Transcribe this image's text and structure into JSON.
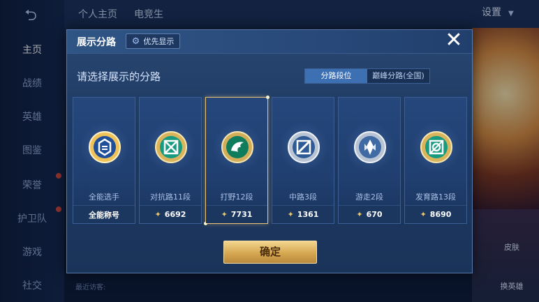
{
  "background": {
    "nav": [
      "主页",
      "战绩",
      "英雄",
      "图鉴",
      "荣誉",
      "护卫队",
      "游戏",
      "社交"
    ],
    "top_tabs": [
      "个人主页",
      "电竞生"
    ],
    "settings_label": "设置",
    "side_actions": [
      "皮肤",
      "换英雄"
    ],
    "recent_label": "最近访客:"
  },
  "modal": {
    "title": "展示分路",
    "priority_label": "优先显示",
    "close_glyph": "✕",
    "subtitle": "请选择展示的分路",
    "toggle": {
      "options": [
        "分路段位",
        "巅峰分路(全国)"
      ],
      "selected": "分路段位"
    },
    "cards": [
      {
        "name": "全能选手",
        "value": "全能称号",
        "selected": false,
        "icon": "all-round-badge-icon"
      },
      {
        "name": "对抗路11段",
        "value": "6692",
        "selected": false,
        "icon": "clash-lane-badge-icon"
      },
      {
        "name": "打野12段",
        "value": "7731",
        "selected": true,
        "icon": "jungle-badge-icon"
      },
      {
        "name": "中路3段",
        "value": "1361",
        "selected": false,
        "icon": "mid-lane-badge-icon"
      },
      {
        "name": "游走2段",
        "value": "670",
        "selected": false,
        "icon": "roam-badge-icon"
      },
      {
        "name": "发育路13段",
        "value": "8690",
        "selected": false,
        "icon": "farm-lane-badge-icon"
      }
    ],
    "confirm_label": "确定"
  },
  "colors": {
    "accent_gold": "#e6c27a",
    "active_tab": "#3d6fb3",
    "confirm_gold": "#d6a852"
  }
}
